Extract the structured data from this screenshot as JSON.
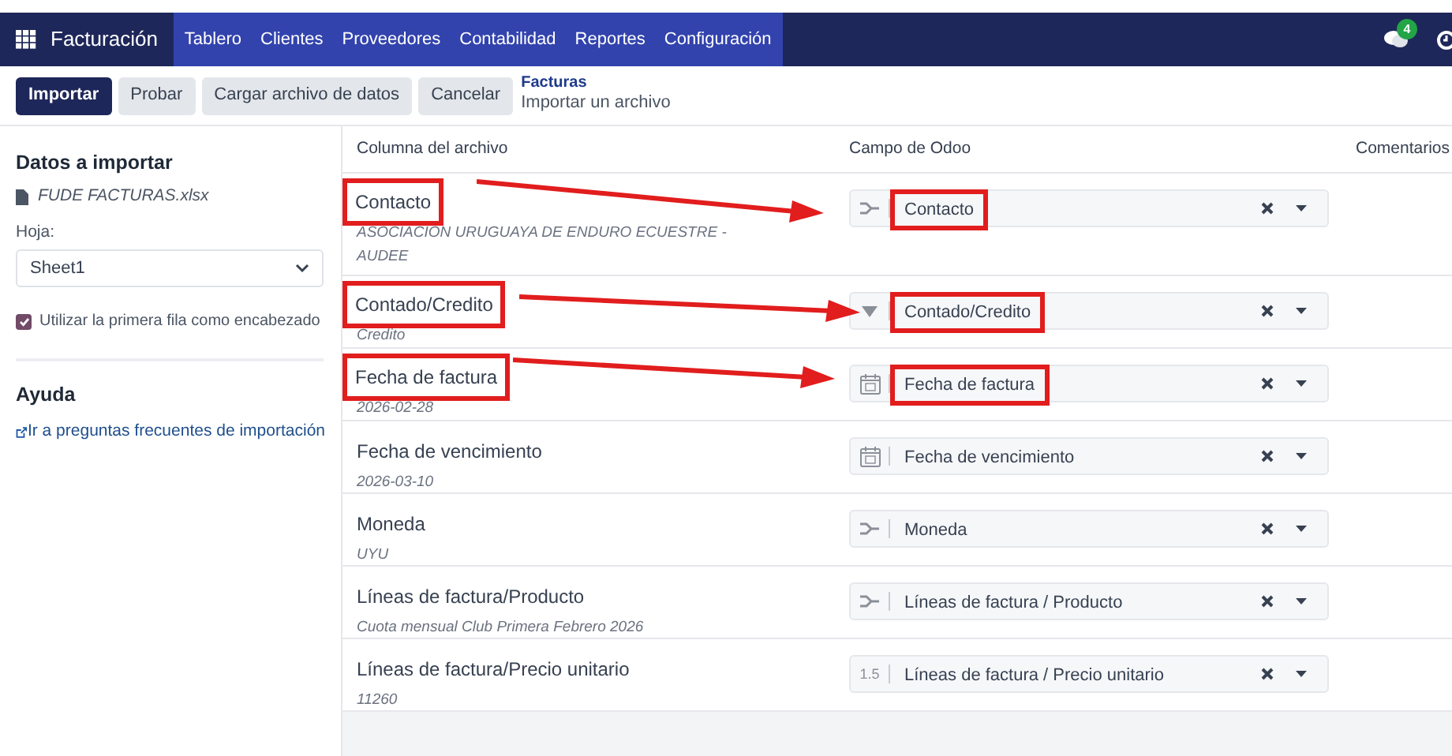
{
  "navbar": {
    "app": "Facturación",
    "menu": [
      "Tablero",
      "Clientes",
      "Proveedores",
      "Contabilidad",
      "Reportes",
      "Configuración"
    ],
    "chat_count": "4"
  },
  "buttons": [
    {
      "label": "Importar",
      "primary": true
    },
    {
      "label": "Probar",
      "primary": false
    },
    {
      "label": "Cargar archivo de datos",
      "primary": false
    },
    {
      "label": "Cancelar",
      "primary": false
    }
  ],
  "breadcrumb": {
    "parent": "Facturas",
    "current": "Importar un archivo"
  },
  "sidebar": {
    "title": "Datos a importar",
    "file": "FUDE FACTURAS.xlsx",
    "sheet_label": "Hoja:",
    "sheet": "Sheet1",
    "header_option": {
      "label": "Utilizar la primera fila como encabezado",
      "checked": true
    },
    "help_title": "Ayuda",
    "help_link": "Ir a preguntas frecuentes de importación"
  },
  "table": {
    "columns": [
      "Columna del archivo",
      "Campo de Odoo",
      "Comentarios"
    ],
    "rows": [
      {
        "column": "Contacto",
        "sample": "ASOCIACION URUGUAYA DE ENDURO ECUESTRE - AUDEE",
        "field": "Contacto",
        "kind": "relation",
        "highlighted": true
      },
      {
        "column": "Contado/Credito",
        "sample": "Credito",
        "field": "Contado/Credito",
        "kind": "selection",
        "highlighted": true
      },
      {
        "column": "Fecha de factura",
        "sample": "2026-02-28",
        "field": "Fecha de factura",
        "kind": "date",
        "highlighted": true
      },
      {
        "column": "Fecha de vencimiento",
        "sample": "2026-03-10",
        "field": "Fecha de vencimiento",
        "kind": "date",
        "highlighted": false
      },
      {
        "column": "Moneda",
        "sample": "UYU",
        "field": "Moneda",
        "kind": "relation",
        "highlighted": false
      },
      {
        "column": "Líneas de factura/Producto",
        "sample": "Cuota mensual Club Primera Febrero 2026",
        "field": "Líneas de factura / Producto",
        "kind": "relation",
        "highlighted": false
      },
      {
        "column": "Líneas de factura/Precio unitario",
        "sample": "11260",
        "field": "Líneas de factura / Precio unitario",
        "kind": "float",
        "icon_label": "1.5",
        "highlighted": false
      }
    ]
  }
}
